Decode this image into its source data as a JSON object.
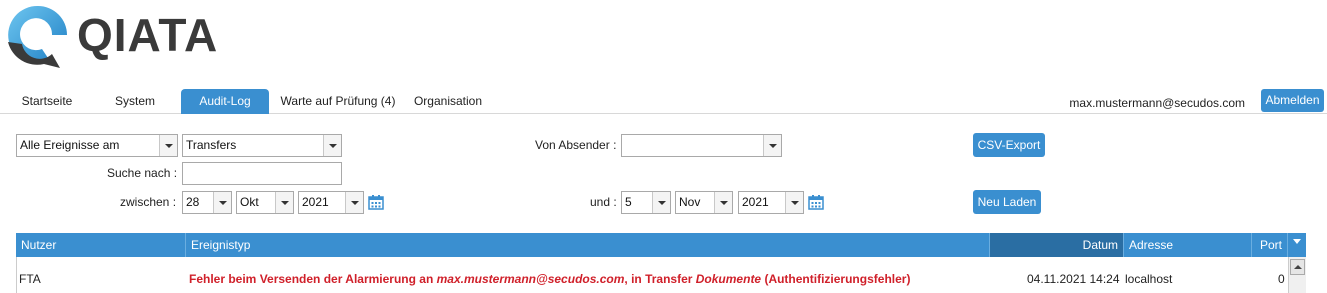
{
  "brand": {
    "name": "QIATA",
    "accent": "#3a8fd0"
  },
  "nav": {
    "tabs": [
      {
        "label": "Startseite"
      },
      {
        "label": "System"
      },
      {
        "label": "Audit-Log"
      },
      {
        "label": "Warte auf Prüfung (4)"
      },
      {
        "label": "Organisation"
      }
    ],
    "active_tab": "Audit-Log",
    "user_email": "max.mustermann@secudos.com",
    "logout_label": "Abmelden"
  },
  "filters": {
    "event_scope": "Alle Ereignisse am",
    "event_type": "Transfers",
    "sender_label": "Von Absender :",
    "sender_value": "",
    "search_label": "Suche nach :",
    "search_value": "",
    "between_label": "zwischen :",
    "from": {
      "day": "28",
      "month": "Okt",
      "year": "2021"
    },
    "and_label": "und :",
    "to": {
      "day": "5",
      "month": "Nov",
      "year": "2021"
    },
    "csv_export_label": "CSV-Export",
    "reload_label": "Neu Laden"
  },
  "table": {
    "columns": [
      "Nutzer",
      "Ereignistyp",
      "Datum",
      "Adresse",
      "Port"
    ],
    "rows": [
      {
        "user": "FTA",
        "event_prefix": "Fehler beim Versenden der Alarmierung an ",
        "event_email": "max.mustermann@secudos.com",
        "event_mid": ", in Transfer ",
        "event_doc": "Dokumente",
        "event_suffix": " (Authentifizierungsfehler)",
        "date": "04.11.2021 14:24",
        "address": "localhost",
        "port": "0"
      }
    ]
  }
}
